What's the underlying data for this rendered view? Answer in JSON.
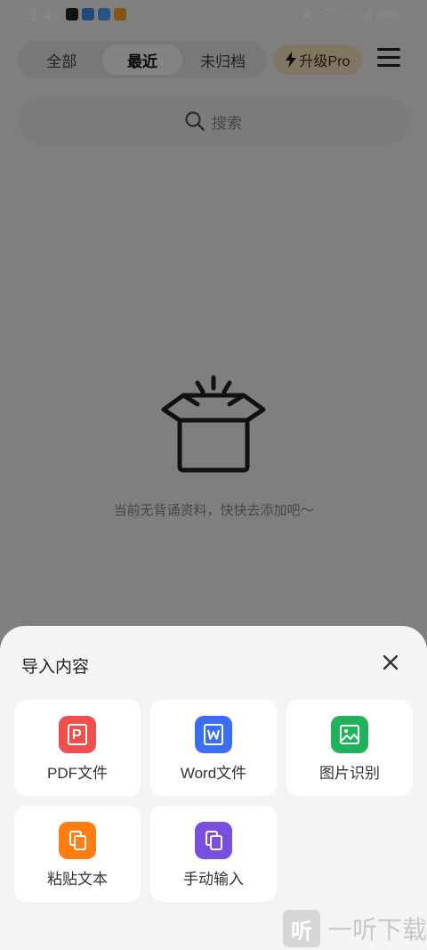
{
  "status_bar": {
    "time": "3:40",
    "network": "4G"
  },
  "header": {
    "tabs": [
      {
        "label": "全部",
        "active": false
      },
      {
        "label": "最近",
        "active": true
      },
      {
        "label": "未归档",
        "active": false
      }
    ],
    "pro_button": "升级Pro"
  },
  "search": {
    "placeholder": "搜索"
  },
  "empty_state": {
    "text": "当前无背诵资料，快快去添加吧～"
  },
  "sheet": {
    "title": "导入内容",
    "items": [
      {
        "label": "PDF文件",
        "icon": "pdf-icon",
        "color": "#ef4f4f"
      },
      {
        "label": "Word文件",
        "icon": "word-icon",
        "color": "#3b6ef5"
      },
      {
        "label": "图片识别",
        "icon": "image-icon",
        "color": "#20b25c"
      },
      {
        "label": "粘贴文本",
        "icon": "paste-icon",
        "color": "#ff7d12"
      },
      {
        "label": "手动输入",
        "icon": "manual-input-icon",
        "color": "#7a4fe0"
      }
    ]
  },
  "watermark": {
    "logo_char": "听",
    "text": "一听下载"
  }
}
